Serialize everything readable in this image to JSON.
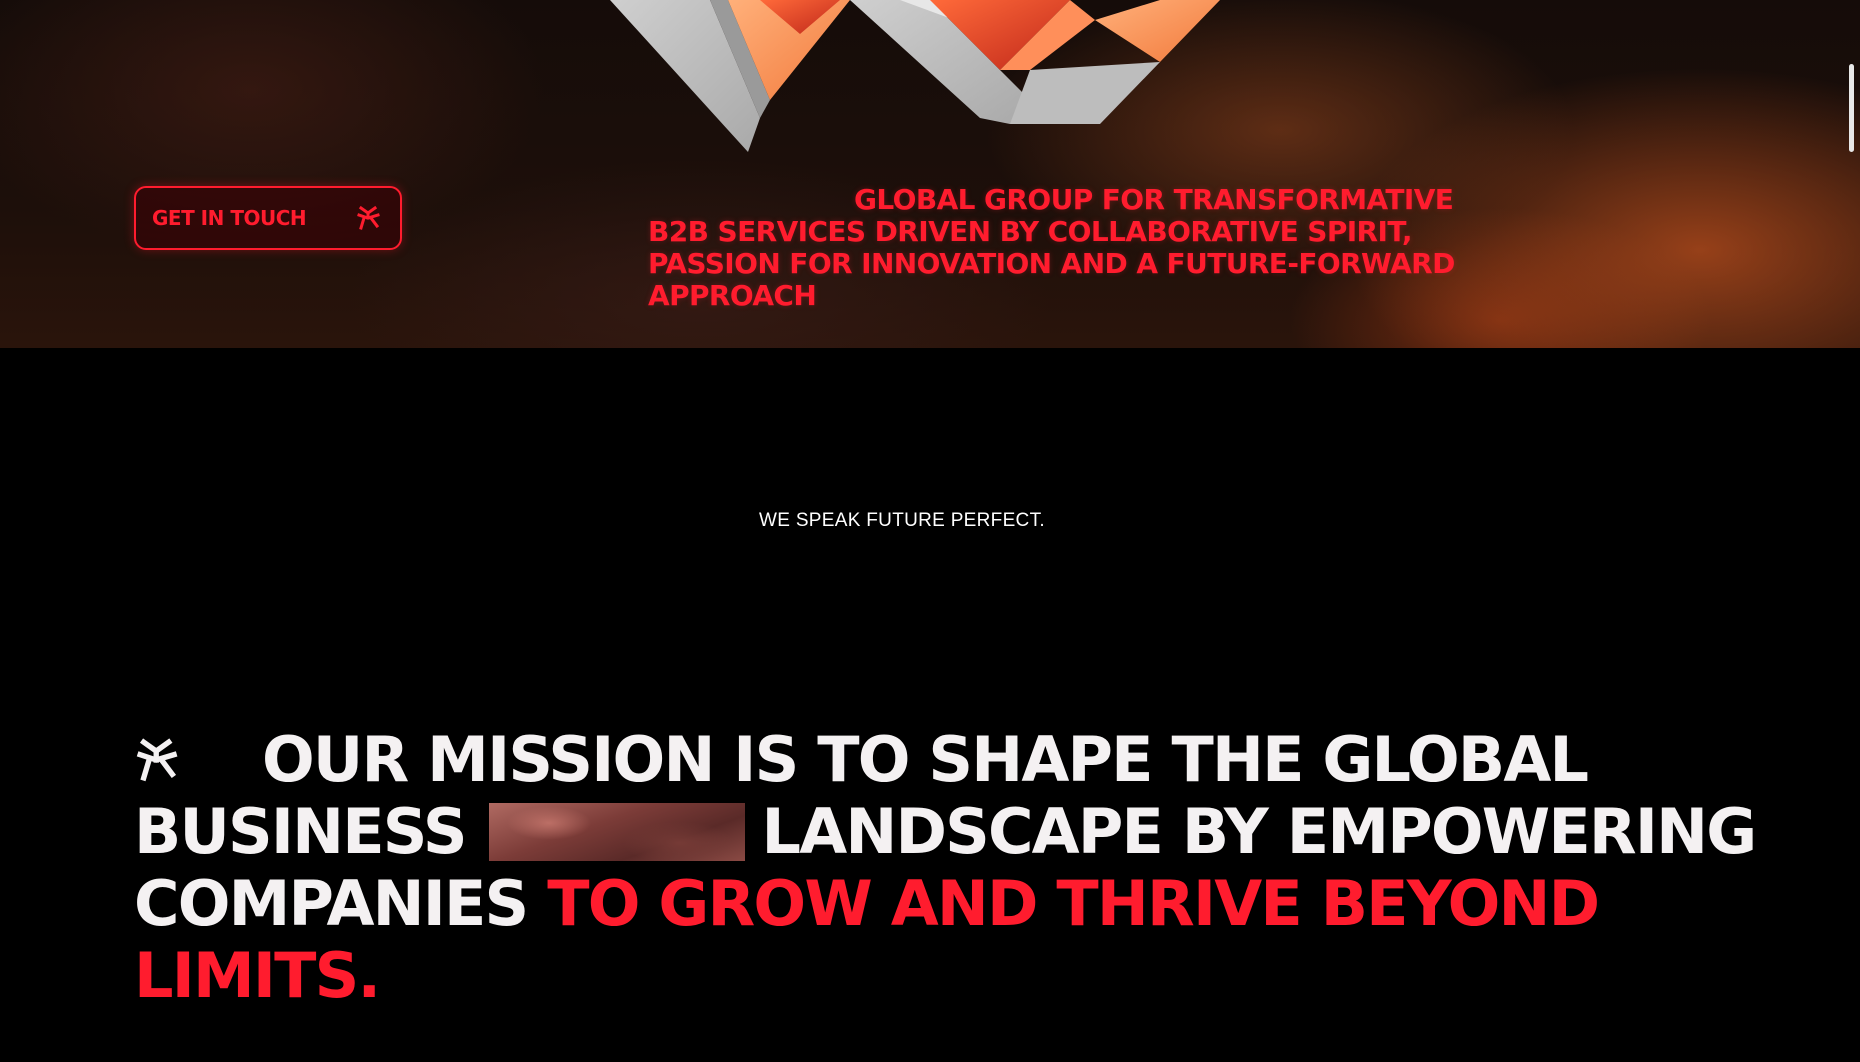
{
  "hero": {
    "cta_label": "GET IN TOUCH",
    "tagline": "GLOBAL GROUP FOR TRANSFORMATIVE B2B SERVICES DRIVEN BY COLLABORATIVE SPIRIT, PASSION FOR INNOVATION AND A FUTURE-FORWARD APPROACH"
  },
  "section": {
    "eyebrow": "WE SPEAK FUTURE PERFECT."
  },
  "mission": {
    "line1": "OUR MISSION IS TO SHAPE THE GLOBAL",
    "line2_start": "BUSINESS",
    "line2_end": "LANDSCAPE BY EMPOWERING",
    "line3_start": "COMPANIES",
    "line3_accent": "TO GROW AND THRIVE BEYOND",
    "line4_accent": "LIMITS."
  },
  "colors": {
    "accent": "#ff1c2e",
    "background": "#000000",
    "text": "#f4f1f2"
  },
  "icons": {
    "cta": "brand-mark-icon",
    "mission": "brand-mark-icon"
  }
}
